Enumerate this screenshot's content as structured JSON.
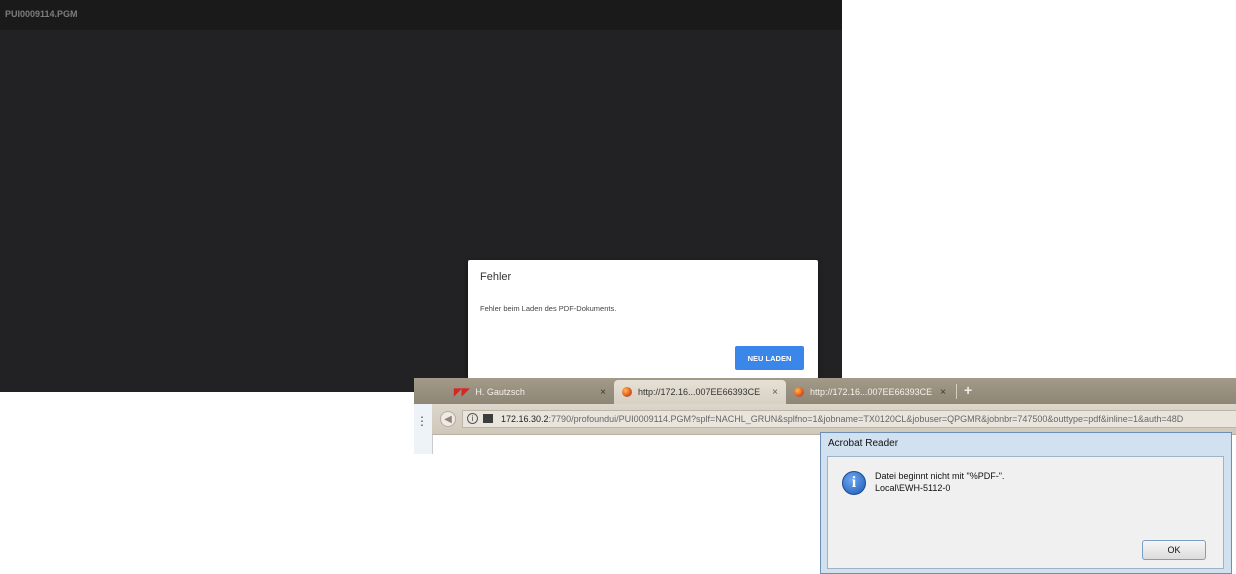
{
  "viewer": {
    "title": "PUI0009114.PGM"
  },
  "error_dialog": {
    "title": "Fehler",
    "message": "Fehler beim Laden des PDF-Dokuments.",
    "button": "NEU LADEN"
  },
  "browser": {
    "tabs": [
      {
        "label": "H. Gautzsch",
        "close": "×",
        "icon": "gautzsch-logo-icon"
      },
      {
        "label": "http://172.16...007EE66393CE",
        "close": "×",
        "icon": "firefox-icon"
      },
      {
        "label": "http://172.16...007EE66393CE",
        "close": "×",
        "icon": "firefox-icon"
      }
    ],
    "new_tab": "+",
    "url_host": "172.16.30.2",
    "url_rest": ":7790/profoundui/PUI0009114.PGM?splf=NACHL_GRUN&splfno=1&jobname=TX0120CL&jobuser=QPGMR&jobnbr=747500&outtype=pdf&inline=1&auth=48D"
  },
  "acrobat_dialog": {
    "title": "Acrobat Reader",
    "message_line1": "Datei beginnt nicht mit \"%PDF-\".",
    "message_line2": "Local\\EWH-5112-0",
    "ok_button": "OK"
  },
  "colors": {
    "viewer_bg": "#222224",
    "primary_button": "#3a86e9",
    "dialog_frame": "#d1e1f0"
  }
}
